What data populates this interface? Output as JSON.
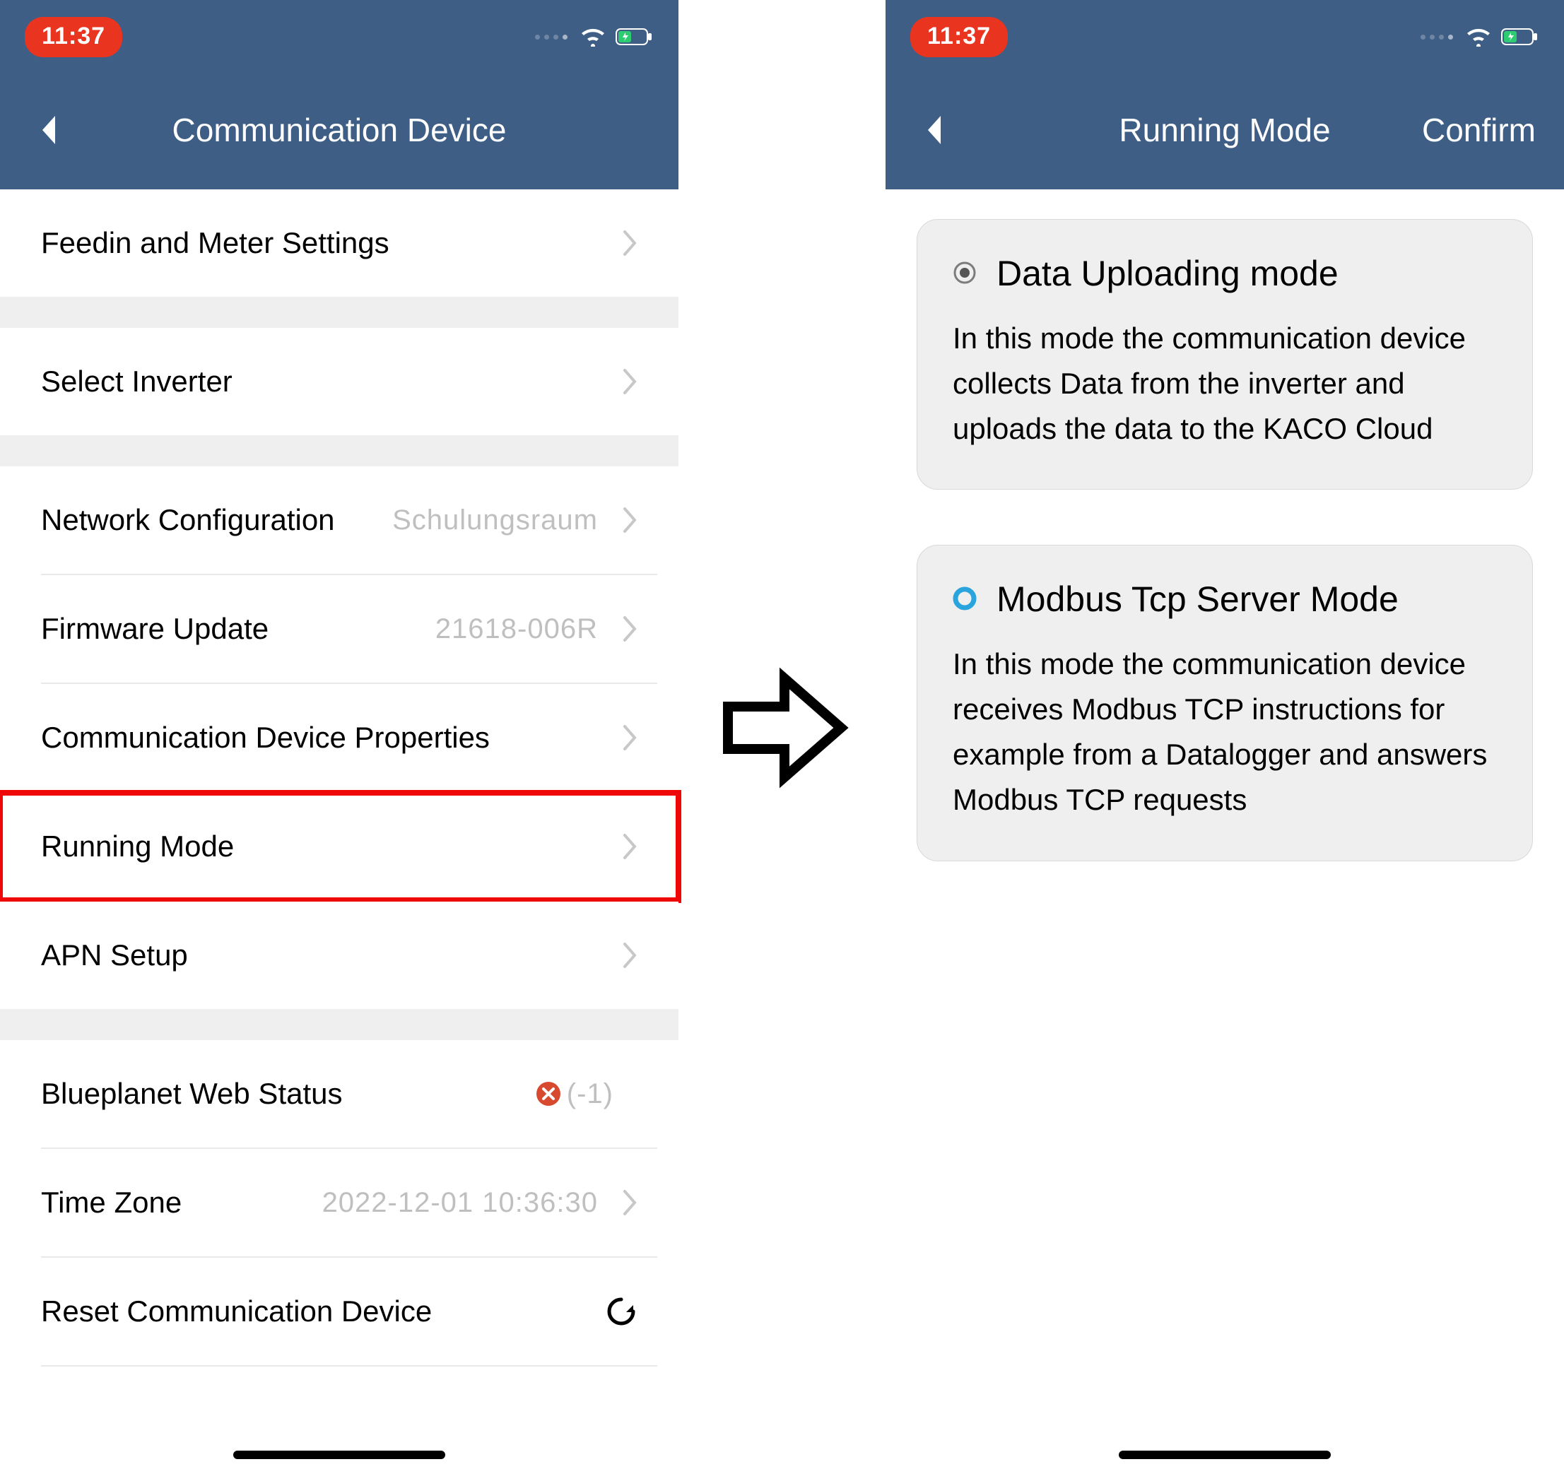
{
  "status": {
    "time": "11:37"
  },
  "left": {
    "title": "Communication Device",
    "rows": {
      "feedin": {
        "label": "Feedin and Meter Settings"
      },
      "select": {
        "label": "Select Inverter"
      },
      "network": {
        "label": "Network Configuration",
        "value": "Schulungsraum"
      },
      "firmware": {
        "label": "Firmware Update",
        "value": "21618-006R"
      },
      "props": {
        "label": "Communication Device Properties"
      },
      "running": {
        "label": "Running Mode"
      },
      "apn": {
        "label": "APN Setup"
      },
      "web": {
        "label": "Blueplanet Web Status",
        "status": "(-1)"
      },
      "tz": {
        "label": "Time Zone",
        "value": "2022-12-01 10:36:30"
      },
      "reset": {
        "label": "Reset Communication Device"
      }
    }
  },
  "right": {
    "title": "Running Mode",
    "confirm": "Confirm",
    "modes": {
      "upload": {
        "title": "Data Uploading mode",
        "desc": "In this mode the communication device collects Data from the inverter and uploads the data to the KACO Cloud"
      },
      "modbus": {
        "title": "Modbus Tcp Server Mode",
        "desc": "In this mode the communication device receives Modbus TCP instructions for example from a Datalogger and answers Modbus TCP requests"
      }
    }
  }
}
